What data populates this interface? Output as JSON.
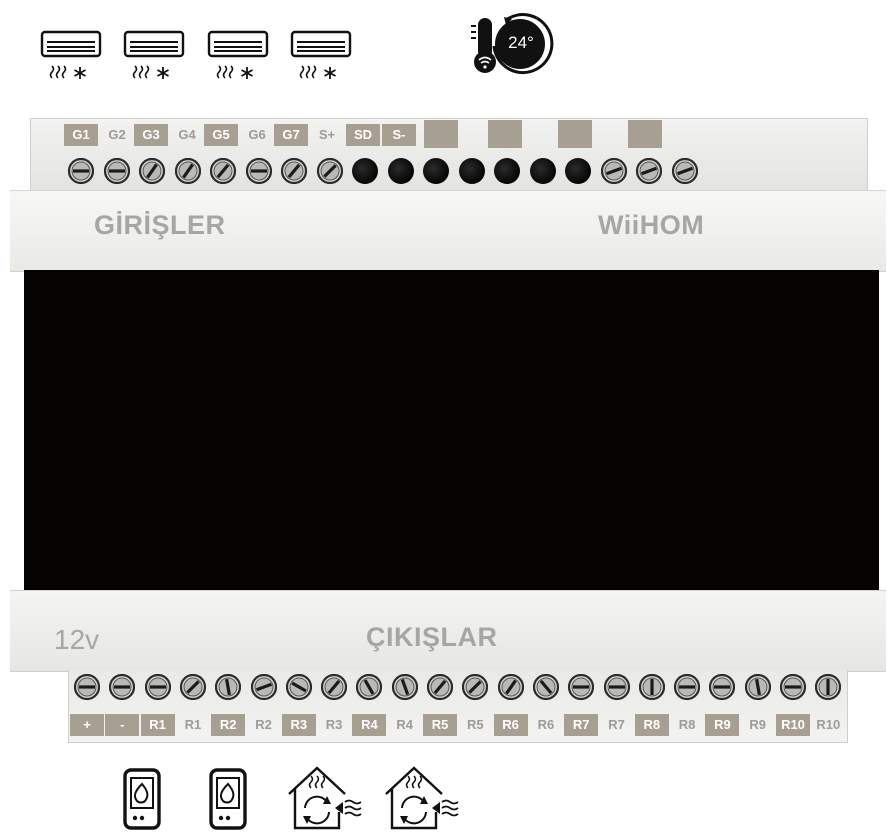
{
  "top_icons": {
    "ac_units": [
      "air-conditioner-icon",
      "air-conditioner-icon",
      "air-conditioner-icon",
      "air-conditioner-icon"
    ],
    "thermostat_temp": "24°"
  },
  "top_labels": [
    "G1",
    "G2",
    "G3",
    "G4",
    "G5",
    "G6",
    "G7",
    "S+",
    "SD",
    "S-"
  ],
  "brand": {
    "inputs_label": "GİRİŞLER",
    "name": "WiiHOM",
    "outputs_label": "ÇIKIŞLAR",
    "voltage": "12v"
  },
  "bottom_labels": [
    "+",
    "-",
    "R1",
    "R1",
    "R2",
    "R2",
    "R3",
    "R3",
    "R4",
    "R4",
    "R5",
    "R5",
    "R6",
    "R6",
    "R7",
    "R7",
    "R8",
    "R8",
    "R9",
    "R9",
    "R10",
    "R10"
  ],
  "bottom_icons": [
    "boiler-icon",
    "boiler-icon",
    "heat-pump-house-icon",
    "heat-pump-house-icon"
  ],
  "colors": {
    "label_highlight": "#a79f91",
    "brand_text": "#a7a6a4",
    "display": "#050202"
  }
}
